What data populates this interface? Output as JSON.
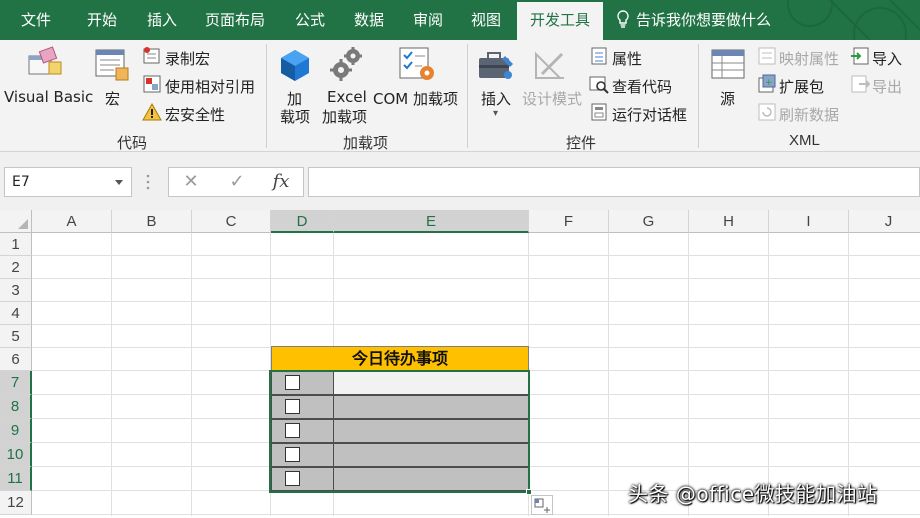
{
  "tabs": [
    {
      "label": "文件"
    },
    {
      "label": "开始"
    },
    {
      "label": "插入"
    },
    {
      "label": "页面布局"
    },
    {
      "label": "公式"
    },
    {
      "label": "数据"
    },
    {
      "label": "审阅"
    },
    {
      "label": "视图"
    },
    {
      "label": "开发工具"
    }
  ],
  "tell_me": "告诉我你想要做什么",
  "ribbon": {
    "code": {
      "visual_basic": "Visual Basic",
      "macros": "宏",
      "record_macro": "录制宏",
      "relative_refs": "使用相对引用",
      "macro_security": "宏安全性",
      "group_label": "代码"
    },
    "addins": {
      "addins_l1": "加",
      "addins_l2": "载项",
      "excel_addins_l1": "Excel",
      "excel_addins_l2": "加载项",
      "com_addins": "COM 加载项",
      "group_label": "加载项"
    },
    "controls": {
      "insert": "插入",
      "design_mode": "设计模式",
      "properties": "属性",
      "view_code": "查看代码",
      "run_dialog": "运行对话框",
      "group_label": "控件"
    },
    "xml": {
      "source": "源",
      "map_properties": "映射属性",
      "expansion_packs": "扩展包",
      "refresh_data": "刷新数据",
      "import": "导入",
      "export": "导出",
      "group_label": "XML"
    }
  },
  "formula_bar": {
    "name_box": "E7",
    "cancel": "✕",
    "enter": "✓",
    "fx": "fx",
    "content": ""
  },
  "columns": [
    "A",
    "B",
    "C",
    "D",
    "E",
    "F",
    "G",
    "H",
    "I",
    "J"
  ],
  "rows": [
    "1",
    "2",
    "3",
    "4",
    "5",
    "6",
    "7",
    "8",
    "9",
    "10",
    "11",
    "12"
  ],
  "todo": {
    "title": "今日待办事项",
    "items": [
      "",
      "",
      "",
      "",
      ""
    ]
  },
  "watermark": "头条 @office微技能加油站"
}
